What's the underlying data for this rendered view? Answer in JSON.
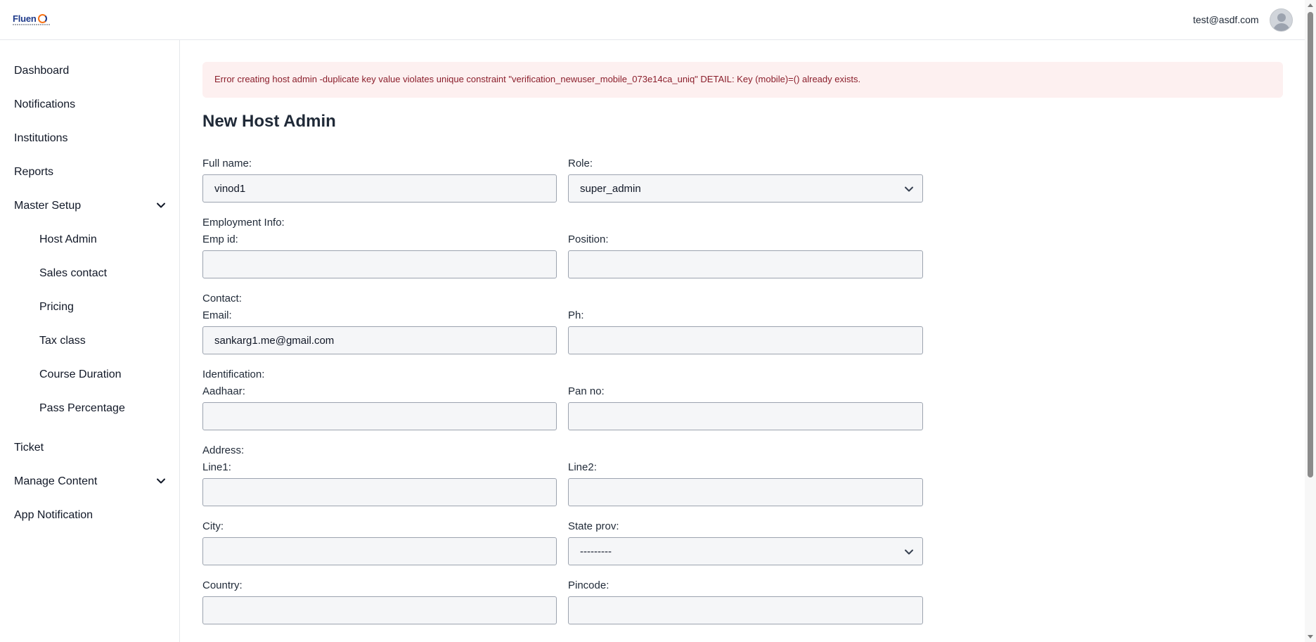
{
  "header": {
    "logo_text": "Fluen",
    "user_email": "test@asdf.com"
  },
  "sidebar": {
    "items": [
      {
        "label": "Dashboard"
      },
      {
        "label": "Notifications"
      },
      {
        "label": "Institutions"
      },
      {
        "label": "Reports"
      },
      {
        "label": "Master Setup",
        "expanded": true
      },
      {
        "label": "Ticket"
      },
      {
        "label": "Manage Content",
        "expanded": false
      },
      {
        "label": "App Notification"
      }
    ],
    "master_setup_sub": [
      {
        "label": "Host Admin"
      },
      {
        "label": "Sales contact"
      },
      {
        "label": "Pricing"
      },
      {
        "label": "Tax class"
      },
      {
        "label": "Course Duration"
      },
      {
        "label": "Pass Percentage"
      }
    ]
  },
  "alert": {
    "text": "Error creating host admin -duplicate key value violates unique constraint \"verification_newuser_mobile_073e14ca_uniq\" DETAIL: Key (mobile)=() already exists."
  },
  "form": {
    "title": "New Host Admin",
    "full_name": {
      "label": "Full name:",
      "value": "vinod1"
    },
    "role": {
      "label": "Role:",
      "value": "super_admin"
    },
    "employment_section": "Employment Info:",
    "emp_id": {
      "label": "Emp id:",
      "value": ""
    },
    "position": {
      "label": "Position:",
      "value": ""
    },
    "contact_section": "Contact:",
    "email": {
      "label": "Email:",
      "value": "sankarg1.me@gmail.com"
    },
    "phone": {
      "label": "Ph:",
      "value": ""
    },
    "identification_section": "Identification:",
    "aadhaar": {
      "label": "Aadhaar:",
      "value": ""
    },
    "pan": {
      "label": "Pan no:",
      "value": ""
    },
    "address_section": "Address:",
    "line1": {
      "label": "Line1:",
      "value": ""
    },
    "line2": {
      "label": "Line2:",
      "value": ""
    },
    "city": {
      "label": "City:",
      "value": ""
    },
    "state": {
      "label": "State prov:",
      "value": "---------"
    },
    "country": {
      "label": "Country:",
      "value": ""
    },
    "pincode": {
      "label": "Pincode:",
      "value": ""
    }
  },
  "colors": {
    "alert_bg": "#fdf0f0",
    "alert_text": "#8b1e2b",
    "field_bg": "#f5f6f8",
    "brand": "#1e3a8a",
    "brand_accent": "#f97316"
  }
}
